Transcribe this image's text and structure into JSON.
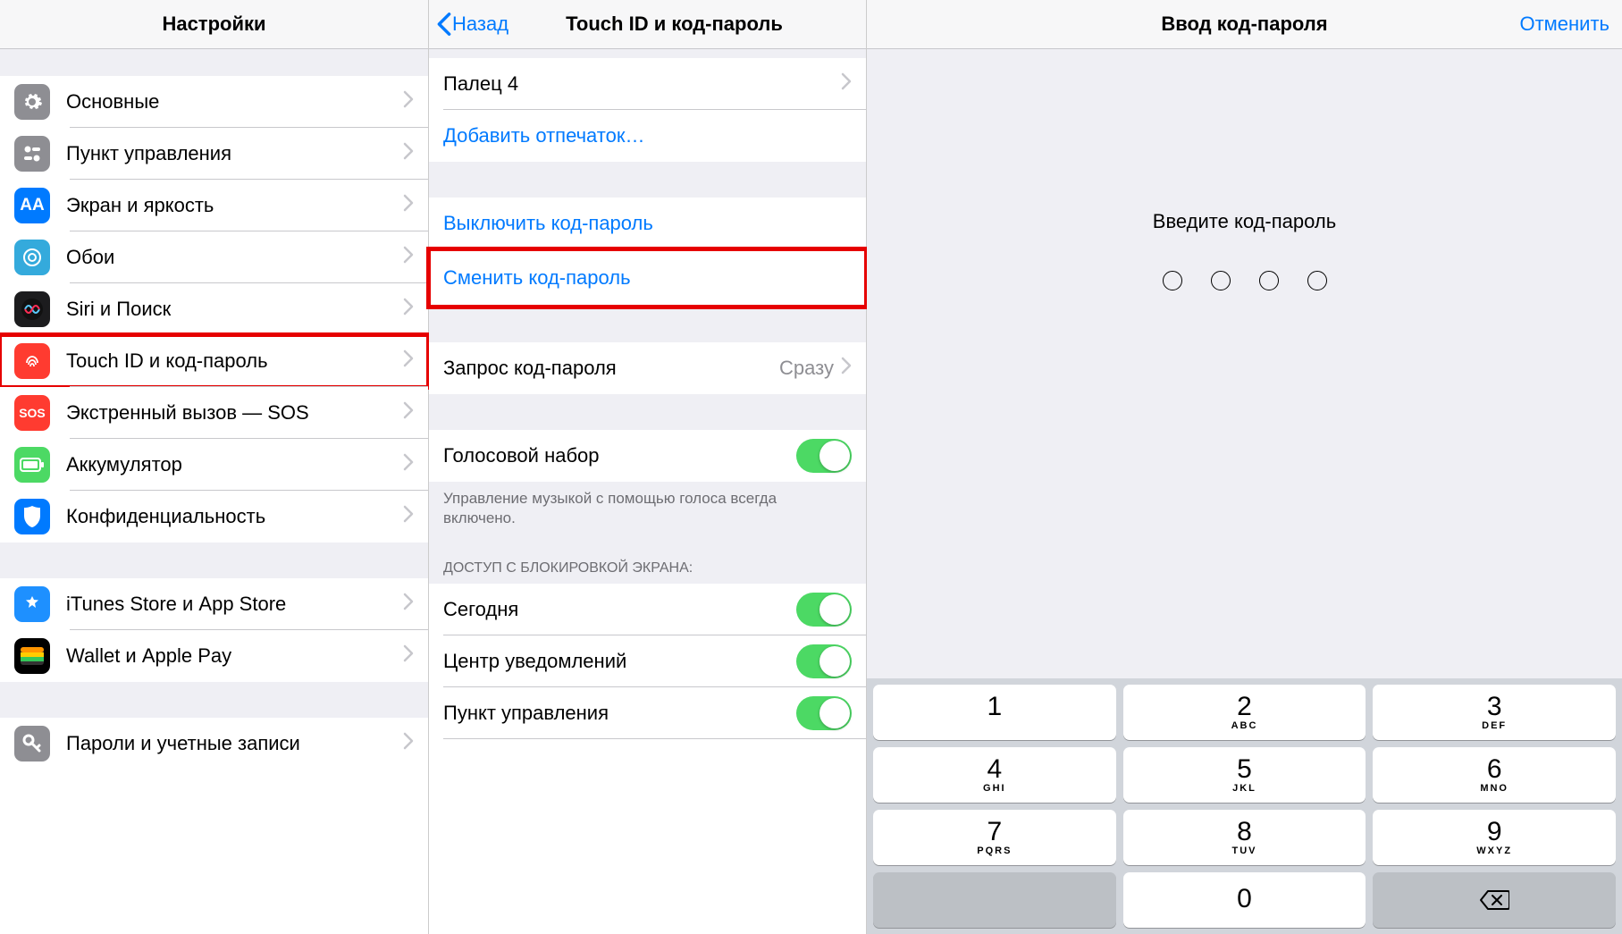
{
  "pane1": {
    "title": "Настройки",
    "groups": [
      [
        {
          "key": "general",
          "icon": "gear",
          "label": "Основные"
        },
        {
          "key": "control-center",
          "icon": "cc",
          "label": "Пункт управления"
        },
        {
          "key": "display",
          "icon": "disp",
          "label": "Экран и яркость"
        },
        {
          "key": "wallpaper",
          "icon": "wall",
          "label": "Обои"
        },
        {
          "key": "siri",
          "icon": "siri",
          "label": "Siri и Поиск"
        },
        {
          "key": "touchid",
          "icon": "touch",
          "label": "Touch ID и код-пароль",
          "highlight": true
        },
        {
          "key": "sos",
          "icon": "sos",
          "label": "Экстренный вызов — SOS"
        },
        {
          "key": "battery",
          "icon": "bat",
          "label": "Аккумулятор"
        },
        {
          "key": "privacy",
          "icon": "priv",
          "label": "Конфиденциальность"
        }
      ],
      [
        {
          "key": "appstore",
          "icon": "as",
          "label": "iTunes Store и App Store"
        },
        {
          "key": "wallet",
          "icon": "wal",
          "label": "Wallet и Apple Pay"
        }
      ],
      [
        {
          "key": "passwords",
          "icon": "pw",
          "label": "Пароли и учетные записи"
        }
      ]
    ]
  },
  "pane2": {
    "back": "Назад",
    "title": "Touch ID и код-пароль",
    "finger4": "Палец 4",
    "add_finger": "Добавить отпечаток…",
    "turn_off": "Выключить код-пароль",
    "change": "Сменить код-пароль",
    "require_label": "Запрос код-пароля",
    "require_value": "Сразу",
    "voice_dial": "Голосовой набор",
    "voice_footer": "Управление музыкой с помощью голоса всегда включено.",
    "lock_header": "ДОСТУП С БЛОКИРОВКОЙ ЭКРАНА:",
    "today": "Сегодня",
    "nc": "Центр уведомлений",
    "cc": "Пункт управления"
  },
  "pane3": {
    "title": "Ввод код-пароля",
    "cancel": "Отменить",
    "prompt": "Введите код-пароль",
    "keys": [
      {
        "d": "1",
        "l": ""
      },
      {
        "d": "2",
        "l": "ABC"
      },
      {
        "d": "3",
        "l": "DEF"
      },
      {
        "d": "4",
        "l": "GHI"
      },
      {
        "d": "5",
        "l": "JKL"
      },
      {
        "d": "6",
        "l": "MNO"
      },
      {
        "d": "7",
        "l": "PQRS"
      },
      {
        "d": "8",
        "l": "TUV"
      },
      {
        "d": "9",
        "l": "WXYZ"
      },
      {
        "d": "0",
        "l": ""
      }
    ]
  }
}
